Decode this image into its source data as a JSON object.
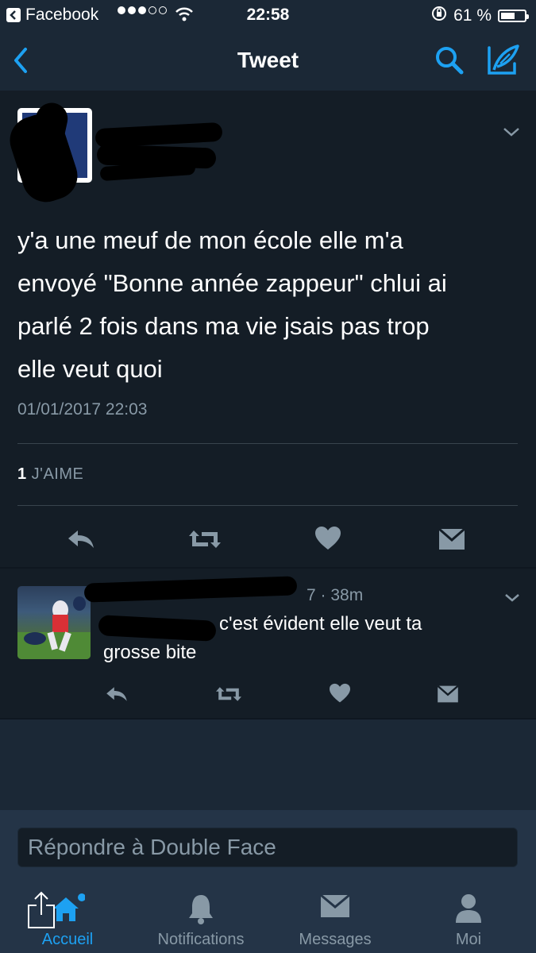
{
  "status_bar": {
    "back_app": "Facebook",
    "time": "22:58",
    "battery": "61 %",
    "battery_level": 0.61
  },
  "navbar": {
    "title": "Tweet"
  },
  "tweet": {
    "text_lines": [
      "y'a une meuf de mon école elle m'a",
      "envoyé \"Bonne année zappeur\" chlui ai",
      "parlé 2 fois dans ma vie jsais pas trop",
      "elle veut quoi"
    ],
    "timestamp": "01/01/2017 22:03",
    "likes_count": "1",
    "likes_label": "J'AIME"
  },
  "reply": {
    "time_fragment": "7 · 38m",
    "text_first": "c'est évident elle veut ta",
    "text_second": "grosse bite"
  },
  "composer": {
    "placeholder": "Répondre à Double Face"
  },
  "tabs": [
    {
      "label": "Accueil",
      "icon": "home-icon",
      "active": true
    },
    {
      "label": "Notifications",
      "icon": "bell-icon",
      "active": false
    },
    {
      "label": "Messages",
      "icon": "envelope-icon",
      "active": false
    },
    {
      "label": "Moi",
      "icon": "person-icon",
      "active": false
    }
  ],
  "colors": {
    "background": "#141d26",
    "bar": "#1b2836",
    "accent": "#1da1f2",
    "muted": "#8899a6"
  }
}
